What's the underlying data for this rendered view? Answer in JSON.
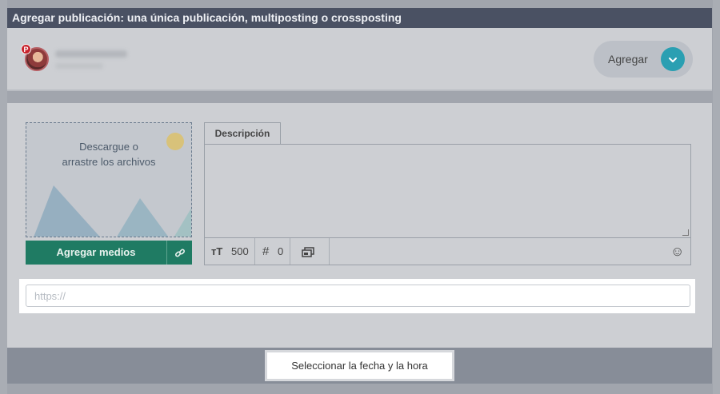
{
  "header": {
    "title": "Agregar publicación: una única publicación, multiposting o crossposting"
  },
  "account": {
    "network_badge": "P",
    "add_button_label": "Agregar",
    "add_button_icon": "chevron-down-icon"
  },
  "media": {
    "drop_line1": "Descargue o",
    "drop_line2": "arrastre los archivos",
    "add_media_label": "Agregar medios",
    "link_icon": "🔗"
  },
  "description": {
    "tab_label": "Descripción",
    "char_icon": "ᴛT",
    "char_count": "500",
    "hashtag_icon": "#",
    "hashtag_count": "0",
    "gallery_icon": "🗗",
    "emoji_icon": "☺"
  },
  "url": {
    "placeholder": "https://"
  },
  "footer": {
    "date_button_label": "Seleccionar la fecha y la hora"
  },
  "colors": {
    "header_bg": "#4a5163",
    "accent_green": "#1f7b63",
    "accent_teal": "#2a9fb2"
  }
}
